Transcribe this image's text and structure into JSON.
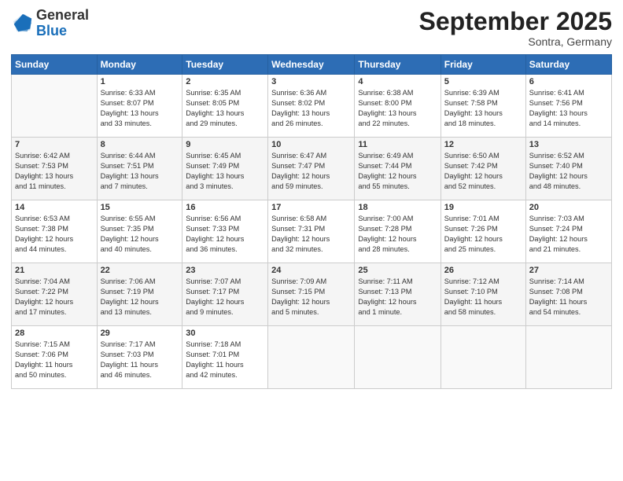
{
  "header": {
    "logo_general": "General",
    "logo_blue": "Blue",
    "month_title": "September 2025",
    "location": "Sontra, Germany"
  },
  "weekdays": [
    "Sunday",
    "Monday",
    "Tuesday",
    "Wednesday",
    "Thursday",
    "Friday",
    "Saturday"
  ],
  "weeks": [
    [
      {
        "day": "",
        "info": ""
      },
      {
        "day": "1",
        "info": "Sunrise: 6:33 AM\nSunset: 8:07 PM\nDaylight: 13 hours\nand 33 minutes."
      },
      {
        "day": "2",
        "info": "Sunrise: 6:35 AM\nSunset: 8:05 PM\nDaylight: 13 hours\nand 29 minutes."
      },
      {
        "day": "3",
        "info": "Sunrise: 6:36 AM\nSunset: 8:02 PM\nDaylight: 13 hours\nand 26 minutes."
      },
      {
        "day": "4",
        "info": "Sunrise: 6:38 AM\nSunset: 8:00 PM\nDaylight: 13 hours\nand 22 minutes."
      },
      {
        "day": "5",
        "info": "Sunrise: 6:39 AM\nSunset: 7:58 PM\nDaylight: 13 hours\nand 18 minutes."
      },
      {
        "day": "6",
        "info": "Sunrise: 6:41 AM\nSunset: 7:56 PM\nDaylight: 13 hours\nand 14 minutes."
      }
    ],
    [
      {
        "day": "7",
        "info": "Sunrise: 6:42 AM\nSunset: 7:53 PM\nDaylight: 13 hours\nand 11 minutes."
      },
      {
        "day": "8",
        "info": "Sunrise: 6:44 AM\nSunset: 7:51 PM\nDaylight: 13 hours\nand 7 minutes."
      },
      {
        "day": "9",
        "info": "Sunrise: 6:45 AM\nSunset: 7:49 PM\nDaylight: 13 hours\nand 3 minutes."
      },
      {
        "day": "10",
        "info": "Sunrise: 6:47 AM\nSunset: 7:47 PM\nDaylight: 12 hours\nand 59 minutes."
      },
      {
        "day": "11",
        "info": "Sunrise: 6:49 AM\nSunset: 7:44 PM\nDaylight: 12 hours\nand 55 minutes."
      },
      {
        "day": "12",
        "info": "Sunrise: 6:50 AM\nSunset: 7:42 PM\nDaylight: 12 hours\nand 52 minutes."
      },
      {
        "day": "13",
        "info": "Sunrise: 6:52 AM\nSunset: 7:40 PM\nDaylight: 12 hours\nand 48 minutes."
      }
    ],
    [
      {
        "day": "14",
        "info": "Sunrise: 6:53 AM\nSunset: 7:38 PM\nDaylight: 12 hours\nand 44 minutes."
      },
      {
        "day": "15",
        "info": "Sunrise: 6:55 AM\nSunset: 7:35 PM\nDaylight: 12 hours\nand 40 minutes."
      },
      {
        "day": "16",
        "info": "Sunrise: 6:56 AM\nSunset: 7:33 PM\nDaylight: 12 hours\nand 36 minutes."
      },
      {
        "day": "17",
        "info": "Sunrise: 6:58 AM\nSunset: 7:31 PM\nDaylight: 12 hours\nand 32 minutes."
      },
      {
        "day": "18",
        "info": "Sunrise: 7:00 AM\nSunset: 7:28 PM\nDaylight: 12 hours\nand 28 minutes."
      },
      {
        "day": "19",
        "info": "Sunrise: 7:01 AM\nSunset: 7:26 PM\nDaylight: 12 hours\nand 25 minutes."
      },
      {
        "day": "20",
        "info": "Sunrise: 7:03 AM\nSunset: 7:24 PM\nDaylight: 12 hours\nand 21 minutes."
      }
    ],
    [
      {
        "day": "21",
        "info": "Sunrise: 7:04 AM\nSunset: 7:22 PM\nDaylight: 12 hours\nand 17 minutes."
      },
      {
        "day": "22",
        "info": "Sunrise: 7:06 AM\nSunset: 7:19 PM\nDaylight: 12 hours\nand 13 minutes."
      },
      {
        "day": "23",
        "info": "Sunrise: 7:07 AM\nSunset: 7:17 PM\nDaylight: 12 hours\nand 9 minutes."
      },
      {
        "day": "24",
        "info": "Sunrise: 7:09 AM\nSunset: 7:15 PM\nDaylight: 12 hours\nand 5 minutes."
      },
      {
        "day": "25",
        "info": "Sunrise: 7:11 AM\nSunset: 7:13 PM\nDaylight: 12 hours\nand 1 minute."
      },
      {
        "day": "26",
        "info": "Sunrise: 7:12 AM\nSunset: 7:10 PM\nDaylight: 11 hours\nand 58 minutes."
      },
      {
        "day": "27",
        "info": "Sunrise: 7:14 AM\nSunset: 7:08 PM\nDaylight: 11 hours\nand 54 minutes."
      }
    ],
    [
      {
        "day": "28",
        "info": "Sunrise: 7:15 AM\nSunset: 7:06 PM\nDaylight: 11 hours\nand 50 minutes."
      },
      {
        "day": "29",
        "info": "Sunrise: 7:17 AM\nSunset: 7:03 PM\nDaylight: 11 hours\nand 46 minutes."
      },
      {
        "day": "30",
        "info": "Sunrise: 7:18 AM\nSunset: 7:01 PM\nDaylight: 11 hours\nand 42 minutes."
      },
      {
        "day": "",
        "info": ""
      },
      {
        "day": "",
        "info": ""
      },
      {
        "day": "",
        "info": ""
      },
      {
        "day": "",
        "info": ""
      }
    ]
  ]
}
